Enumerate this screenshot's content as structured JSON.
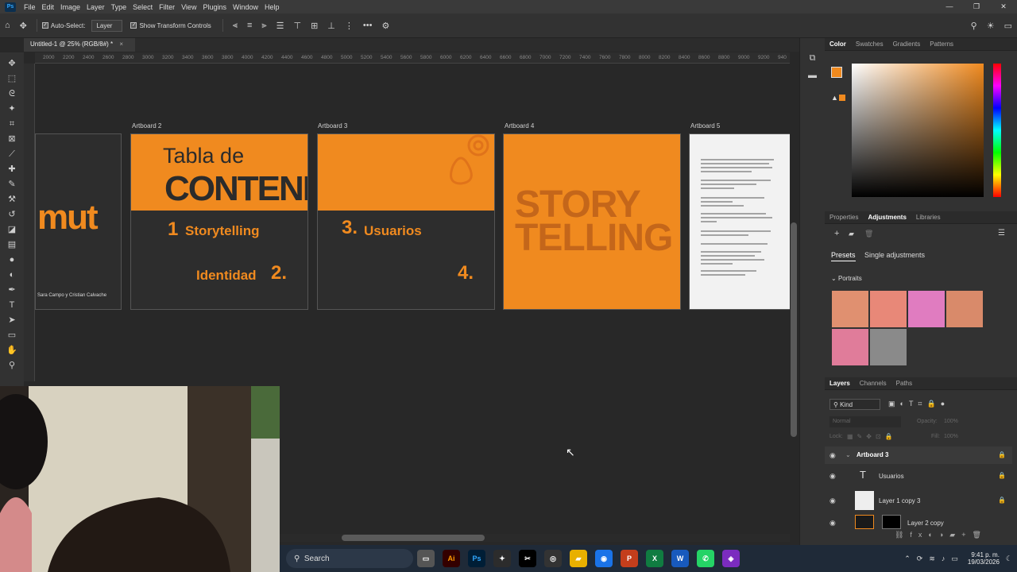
{
  "menubar": {
    "app_icon": "Ps",
    "items": [
      "File",
      "Edit",
      "Image",
      "Layer",
      "Type",
      "Select",
      "Filter",
      "View",
      "Plugins",
      "Window",
      "Help"
    ],
    "window_controls": [
      "—",
      "❐",
      "✕"
    ]
  },
  "options": {
    "auto_select_label": "Auto-Select:",
    "auto_select_value": "Layer",
    "transform_label": "Show Transform Controls"
  },
  "document": {
    "tab_title": "Untitled-1 @ 25% (RGB/8#) *",
    "close": "×"
  },
  "ruler": {
    "ticks": [
      "2000",
      "2200",
      "2400",
      "2600",
      "2800",
      "3000",
      "3200",
      "3400",
      "3600",
      "3800",
      "4000",
      "4200",
      "4400",
      "4600",
      "4800",
      "5000",
      "5200",
      "5400",
      "5600",
      "5800",
      "6000",
      "6200",
      "6400",
      "6600",
      "6800",
      "7000",
      "7200",
      "7400",
      "7600",
      "7800",
      "8000",
      "8200",
      "8400",
      "8600",
      "8800",
      "9000",
      "9200",
      "940"
    ]
  },
  "artboards": {
    "ab2_label": "Artboard 2",
    "ab3_label": "Artboard 3",
    "ab4_label": "Artboard 4",
    "ab5_label": "Artboard 5",
    "ab1_big": "mut",
    "ab1_credit": "Sara Campo y Cristian Calvache",
    "tabla": "Tabla de",
    "contenidos": "CONTENIDOS",
    "item1_num": "1",
    "item1": "Storytelling",
    "item2": "Identidad",
    "item2_num": "2.",
    "item3_num": "3.",
    "item3": "Usuarios",
    "item4_num": "4.",
    "story1": "STORY",
    "story2": "TELLING"
  },
  "right_panel": {
    "color_tabs": [
      "Color",
      "Swatches",
      "Gradients",
      "Patterns"
    ],
    "props_tabs": [
      "Properties",
      "Adjustments",
      "Libraries"
    ],
    "presets_tabs": [
      "Presets",
      "Single adjustments"
    ],
    "portraits_label": "Portraits",
    "layers_tabs": [
      "Layers",
      "Channels",
      "Paths"
    ],
    "kind_label": "Kind",
    "blend_mode": "Normal",
    "opacity_label": "Opacity:",
    "opacity_value": "100%",
    "lock_label": "Lock:",
    "fill_label": "Fill:",
    "fill_value": "100%",
    "layers": [
      {
        "name": "Artboard 3",
        "type": "artboard"
      },
      {
        "name": "Usuarios",
        "type": "text"
      },
      {
        "name": "Layer 1 copy 3",
        "type": "pixel"
      },
      {
        "name": "Layer 2 copy",
        "type": "pixel"
      }
    ],
    "accent_color": "#f08a1f"
  },
  "taskbar": {
    "search_label": "Search",
    "time": "9:41 p. m.",
    "date": "19/03/2026"
  }
}
